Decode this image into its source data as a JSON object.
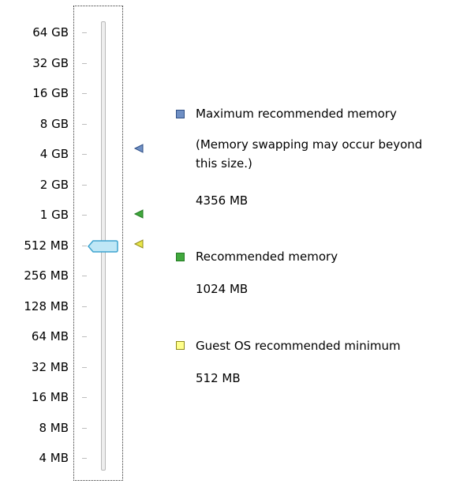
{
  "slider": {
    "ticks": [
      {
        "label": "64 GB"
      },
      {
        "label": "32 GB"
      },
      {
        "label": "16 GB"
      },
      {
        "label": "8 GB"
      },
      {
        "label": "4 GB"
      },
      {
        "label": "2 GB"
      },
      {
        "label": "1 GB"
      },
      {
        "label": "512 MB"
      },
      {
        "label": "256 MB"
      },
      {
        "label": "128 MB"
      },
      {
        "label": "64 MB"
      },
      {
        "label": "32 MB"
      },
      {
        "label": "16 MB"
      },
      {
        "label": "8 MB"
      },
      {
        "label": "4 MB"
      }
    ],
    "current_value": "512 MB",
    "thumb_color": "#bfe7f6",
    "thumb_border": "#3ea4cf",
    "track_color": "#eeeeee"
  },
  "markers": {
    "max_recommended": {
      "value": "4 GB",
      "color": "#6f8fc4",
      "icon": "triangle-left-icon"
    },
    "recommended": {
      "value": "1 GB",
      "color": "#41a83d",
      "icon": "triangle-left-icon"
    },
    "guest_min": {
      "value": "512 MB",
      "color": "#e8e54a",
      "icon": "triangle-left-icon"
    }
  },
  "legend": {
    "max_recommended": {
      "title": "Maximum recommended memory",
      "note": "(Memory swapping may occur beyond this size.)",
      "value": "4356 MB",
      "color": "#6f8fc4"
    },
    "recommended": {
      "title": "Recommended memory",
      "value": "1024 MB",
      "color": "#41a83d"
    },
    "guest_min": {
      "title": "Guest OS recommended minimum",
      "value": "512 MB",
      "color": "#e8e54a"
    }
  }
}
